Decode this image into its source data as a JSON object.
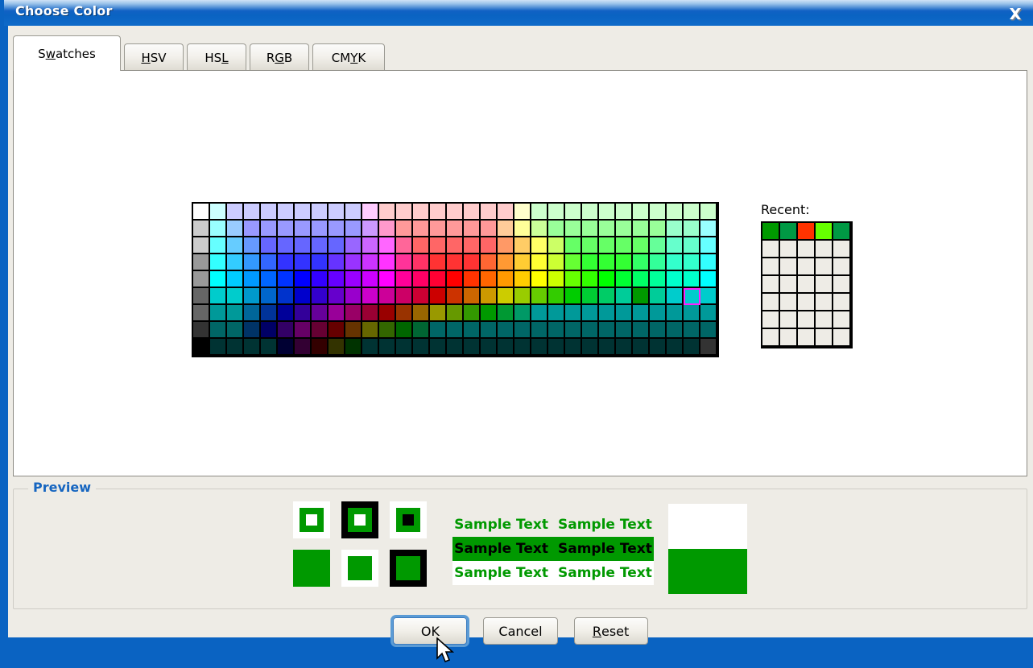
{
  "window": {
    "title": "Choose Color",
    "close_icon": "close-icon"
  },
  "tabs": [
    {
      "label": "Swatches",
      "mnemonic_index": 1,
      "selected": true
    },
    {
      "label": "HSV",
      "mnemonic_index": 0,
      "selected": false
    },
    {
      "label": "HSL",
      "mnemonic_index": 2,
      "selected": false
    },
    {
      "label": "RGB",
      "mnemonic_index": 1,
      "selected": false
    },
    {
      "label": "CMYK",
      "mnemonic_index": 2,
      "selected": false
    }
  ],
  "swatches": {
    "columns": 31,
    "rows": 9,
    "selected_col": 29,
    "selected_row": 5,
    "selected_color": "#009900",
    "selection_highlight": "#ff20ff",
    "colors": [
      [
        "#ffffff",
        "#ccffff",
        "#ccccff",
        "#ccccff",
        "#ccccff",
        "#ccccff",
        "#ccccff",
        "#ccccff",
        "#ccccff",
        "#ccccff",
        "#ffccff",
        "#ffcccc",
        "#ffcccc",
        "#ffcccc",
        "#ffcccc",
        "#ffcccc",
        "#ffcccc",
        "#ffcccc",
        "#ffcccc",
        "#ffffcc",
        "#ccffcc",
        "#ccffcc",
        "#ccffcc",
        "#ccffcc",
        "#ccffcc",
        "#ccffcc",
        "#ccffcc",
        "#ccffcc",
        "#ccffcc",
        "#ccffcc",
        "#ccffcc"
      ],
      [
        "#cccccc",
        "#99ffff",
        "#99ccff",
        "#9999ff",
        "#9999ff",
        "#9999ff",
        "#9999ff",
        "#9999ff",
        "#9999ff",
        "#9999ff",
        "#cc99ff",
        "#ff99cc",
        "#ff9999",
        "#ff9999",
        "#ff9999",
        "#ff9999",
        "#ff9999",
        "#ff9999",
        "#ffcc99",
        "#ffff99",
        "#ccff99",
        "#99ff99",
        "#99ff99",
        "#99ff99",
        "#99ff99",
        "#99ff99",
        "#99ff99",
        "#99ff99",
        "#99ffcc",
        "#99ffcc",
        "#99ffff"
      ],
      [
        "#cccccc",
        "#66ffff",
        "#66ccff",
        "#6699ff",
        "#6666ff",
        "#6666ff",
        "#6666ff",
        "#6666ff",
        "#6666ff",
        "#9966ff",
        "#cc66ff",
        "#ff66ff",
        "#ff6699",
        "#ff6666",
        "#ff6666",
        "#ff6666",
        "#ff6666",
        "#ff6666",
        "#ff9966",
        "#ffcc66",
        "#ffff66",
        "#ccff66",
        "#66ff66",
        "#66ff66",
        "#66ff66",
        "#66ff66",
        "#66ff66",
        "#66ff99",
        "#66ffcc",
        "#66ffcc",
        "#66ffff"
      ],
      [
        "#999999",
        "#33ffff",
        "#33ccff",
        "#3399ff",
        "#3366ff",
        "#3333ff",
        "#3333ff",
        "#3333ff",
        "#6633ff",
        "#9933ff",
        "#cc33ff",
        "#ff33ff",
        "#ff3399",
        "#ff3366",
        "#ff3333",
        "#ff3333",
        "#ff3333",
        "#ff6633",
        "#ff9933",
        "#ffcc33",
        "#ffff33",
        "#ccff33",
        "#66ff33",
        "#33ff33",
        "#33ff33",
        "#33ff33",
        "#33ff66",
        "#33ff99",
        "#33ffcc",
        "#33ffcc",
        "#33ffff"
      ],
      [
        "#999999",
        "#00ffff",
        "#00ccff",
        "#0099ff",
        "#0066ff",
        "#0033ff",
        "#0000ff",
        "#3300ff",
        "#6600ff",
        "#9900ff",
        "#cc00ff",
        "#ff00ff",
        "#ff0099",
        "#ff0066",
        "#ff0033",
        "#ff0000",
        "#ff3300",
        "#ff6600",
        "#ff9900",
        "#ffcc00",
        "#ffff00",
        "#ccff00",
        "#66ff00",
        "#33ff00",
        "#00ff00",
        "#00ff33",
        "#00ff66",
        "#00ff99",
        "#00ffcc",
        "#00ffcc",
        "#00ffff"
      ],
      [
        "#666666",
        "#00cccc",
        "#00cc cc",
        "#0099cc",
        "#0066cc",
        "#0033cc",
        "#0000cc",
        "#3300cc",
        "#6600cc",
        "#9900cc",
        "#cc00cc",
        "#cc0099",
        "#cc0066",
        "#cc0033",
        "#cc0000",
        "#cc3300",
        "#cc6600",
        "#cc9900",
        "#cccc00",
        "#99cc00",
        "#66cc00",
        "#33cc00",
        "#00cc00",
        "#00cc33",
        "#00cc66",
        "#00cc99",
        "#009900",
        "#00cc99",
        "#00cccc",
        "#00cccc",
        "#00cccc"
      ],
      [
        "#666666",
        "#009999",
        "#009999",
        "#006699",
        "#003399",
        "#000099",
        "#330099",
        "#660099",
        "#990099",
        "#990066",
        "#990033",
        "#990000",
        "#993300",
        "#996600",
        "#999900",
        "#669900",
        "#339900",
        "#009900",
        "#009933",
        "#009966",
        "#009999",
        "#009999",
        "#009999",
        "#009999",
        "#009999",
        "#009999",
        "#009999",
        "#009999",
        "#009999",
        "#009999",
        "#009999"
      ],
      [
        "#333333",
        "#006666",
        "#006666",
        "#003366",
        "#000066",
        "#330066",
        "#660066",
        "#660033",
        "#660000",
        "#663300",
        "#666600",
        "#336600",
        "#006600",
        "#006633",
        "#006666",
        "#006666",
        "#006666",
        "#006666",
        "#006666",
        "#006666",
        "#006666",
        "#006666",
        "#006666",
        "#006666",
        "#006666",
        "#006666",
        "#006666",
        "#006666",
        "#006666",
        "#006666",
        "#006666"
      ],
      [
        "#000000",
        "#003333",
        "#003333",
        "#003333",
        "#003333",
        "#000033",
        "#330033",
        "#330000",
        "#333300",
        "#003300",
        "#003333",
        "#003333",
        "#003333",
        "#003333",
        "#003333",
        "#003333",
        "#003333",
        "#003333",
        "#003333",
        "#003333",
        "#003333",
        "#003333",
        "#003333",
        "#003333",
        "#003333",
        "#003333",
        "#003333",
        "#003333",
        "#003333",
        "#003333",
        "#333333"
      ]
    ]
  },
  "recent": {
    "label": "Recent:",
    "columns": 5,
    "rows": 7,
    "colors": [
      "#009900",
      "#009944",
      "#ff3300",
      "#66ff00",
      "#009944"
    ],
    "empty_color": "#eeece6"
  },
  "preview": {
    "legend": "Preview",
    "selected_color": "#009900",
    "sample_text": "Sample Text",
    "rows": [
      {
        "fg": "#009900",
        "bg": "#eeece6"
      },
      {
        "fg": "#000000",
        "bg": "#009900"
      },
      {
        "fg": "#009900",
        "bg": "#ffffff"
      }
    ],
    "demo_boxes": [
      {
        "outer": "#ffffff",
        "mid": "#009900",
        "core": "#ffffff"
      },
      {
        "outer": "#000000",
        "mid": "#009900",
        "core": "#ffffff"
      },
      {
        "outer": "#ffffff",
        "mid": "#009900",
        "core": "#000000"
      },
      {
        "outer": "#009900",
        "mid": "#009900",
        "core": "#009900"
      },
      {
        "outer": "#ffffff",
        "mid": "#009900",
        "core": "#009900"
      },
      {
        "outer": "#000000",
        "mid": "#009900",
        "core": "#009900"
      }
    ],
    "solid_top": "#ffffff",
    "solid_bottom": "#009900"
  },
  "buttons": [
    {
      "label": "OK",
      "mnemonic_index": -1,
      "focused": true
    },
    {
      "label": "Cancel",
      "mnemonic_index": -1,
      "focused": false
    },
    {
      "label": "Reset",
      "mnemonic_index": 0,
      "focused": false
    }
  ],
  "colors": {
    "titlebar_blue": "#0a63c2",
    "dialog_bg": "#eeece6",
    "legend_blue": "#1565c0",
    "focus_ring": "#5b9bd5"
  }
}
